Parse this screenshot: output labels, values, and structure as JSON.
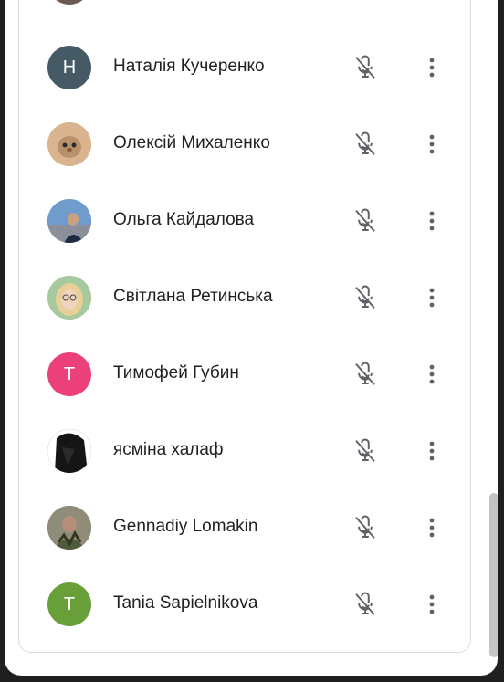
{
  "participants": [
    {
      "name": "",
      "avatar_letter": "",
      "avatar_color": "#6b5a52",
      "avatar_type": "photo"
    },
    {
      "name": "Наталія Кучеренко",
      "avatar_letter": "Н",
      "avatar_color": "#465a65",
      "avatar_type": "letter"
    },
    {
      "name": "Олексій Михаленко",
      "avatar_letter": "",
      "avatar_color": "#c9a07a",
      "avatar_type": "photo"
    },
    {
      "name": "Ольга Кайдалова",
      "avatar_letter": "",
      "avatar_color": "#5a86b8",
      "avatar_type": "photo"
    },
    {
      "name": "Світлана Ретинська",
      "avatar_letter": "",
      "avatar_color": "#e3c18a",
      "avatar_type": "photo"
    },
    {
      "name": "Тимофей Губин",
      "avatar_letter": "Т",
      "avatar_color": "#ec407a",
      "avatar_type": "letter"
    },
    {
      "name": "ясміна халаф",
      "avatar_letter": "",
      "avatar_color": "#1a1a1a",
      "avatar_type": "photo"
    },
    {
      "name": "Gennadiy Lomakin",
      "avatar_letter": "",
      "avatar_color": "#6a6b52",
      "avatar_type": "photo"
    },
    {
      "name": "Tania Sapielnikova",
      "avatar_letter": "T",
      "avatar_color": "#689f38",
      "avatar_type": "letter"
    }
  ],
  "icons": {
    "mic": "mic-off-icon",
    "more": "more-vert-icon"
  }
}
